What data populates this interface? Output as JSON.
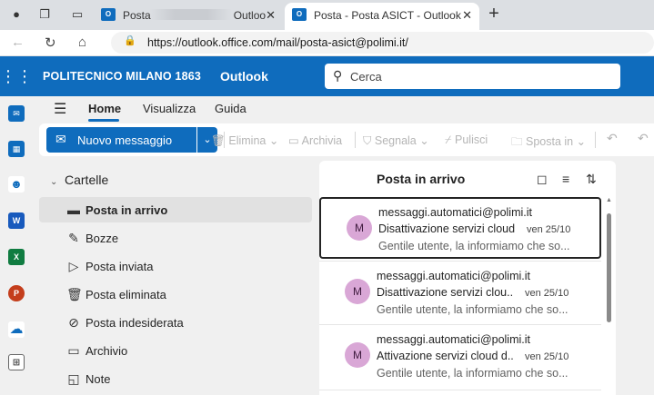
{
  "browser": {
    "tabs": [
      {
        "title": "Posta",
        "title_suffix": "Outloo"
      },
      {
        "title": "Posta - Posta ASICT - Outlook"
      }
    ],
    "url": "https://outlook.office.com/mail/posta-asict@polimi.it/"
  },
  "header": {
    "org": "POLITECNICO MILANO 1863",
    "app": "Outlook",
    "search_placeholder": "Cerca"
  },
  "ribbon": {
    "tabs": [
      "Home",
      "Visualizza",
      "Guida"
    ],
    "new_message": "Nuovo messaggio",
    "actions": [
      "Elimina",
      "Archivia",
      "Segnala",
      "Pulisci",
      "Sposta in"
    ]
  },
  "folders": {
    "heading": "Cartelle",
    "items": [
      {
        "label": "Posta in arrivo",
        "icon": "inbox-icon",
        "selected": true
      },
      {
        "label": "Bozze",
        "icon": "draft-icon"
      },
      {
        "label": "Posta inviata",
        "icon": "send-icon"
      },
      {
        "label": "Posta eliminata",
        "icon": "trash-icon"
      },
      {
        "label": "Posta indesiderata",
        "icon": "junk-icon"
      },
      {
        "label": "Archivio",
        "icon": "archive-icon"
      },
      {
        "label": "Note",
        "icon": "note-icon"
      }
    ]
  },
  "message_list": {
    "title": "Posta in arrivo",
    "messages": [
      {
        "initial": "M",
        "from": "messaggi.automatici@polimi.it",
        "subject": "Disattivazione servizi cloud...",
        "date": "ven 25/10",
        "preview": "Gentile utente, la informiamo che so..."
      },
      {
        "initial": "M",
        "from": "messaggi.automatici@polimi.it",
        "subject": "Disattivazione servizi clou...",
        "date": "ven 25/10",
        "preview": "Gentile utente, la informiamo che so..."
      },
      {
        "initial": "M",
        "from": "messaggi.automatici@polimi.it",
        "subject": "Attivazione servizi cloud d...",
        "date": "ven 25/10",
        "preview": "Gentile utente, la informiamo che so..."
      }
    ]
  },
  "colors": {
    "brand": "#0f6cbd",
    "avatar": "#d9a7d6"
  }
}
